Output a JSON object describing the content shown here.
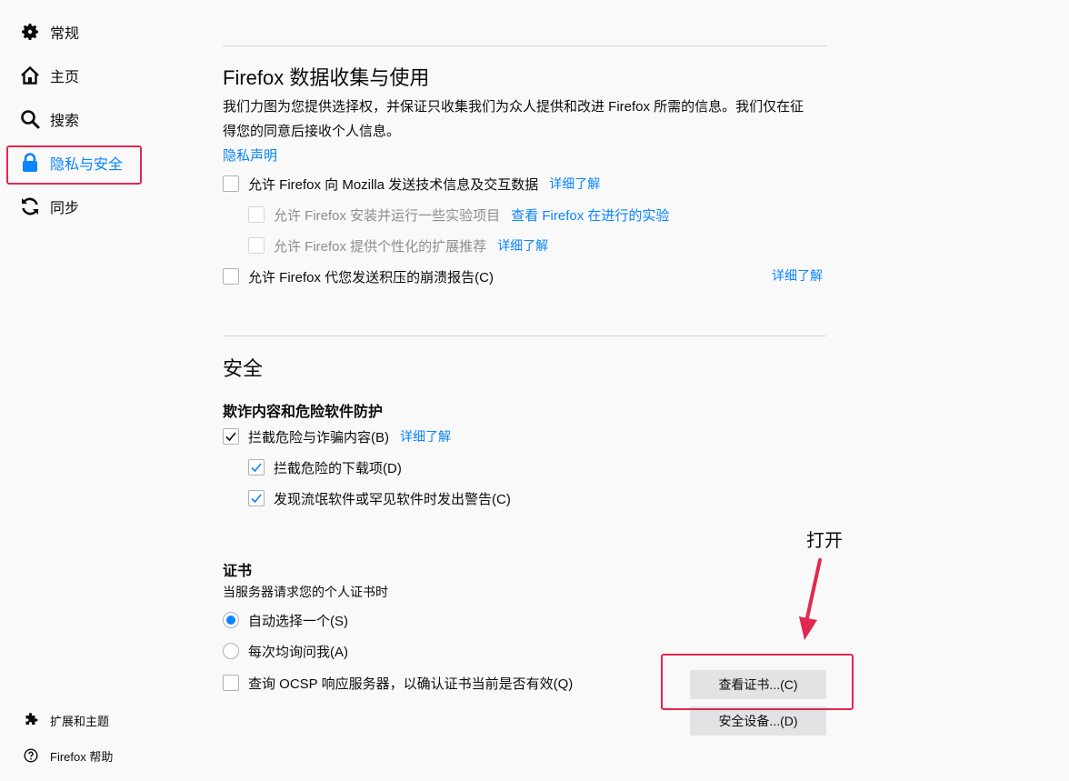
{
  "sidebar": {
    "items": [
      {
        "label": "常规",
        "icon": "gear-icon"
      },
      {
        "label": "主页",
        "icon": "home-icon"
      },
      {
        "label": "搜索",
        "icon": "search-icon"
      },
      {
        "label": "隐私与安全",
        "icon": "lock-icon",
        "active": true
      },
      {
        "label": "同步",
        "icon": "sync-icon"
      }
    ],
    "footer": [
      {
        "label": "扩展和主题",
        "icon": "puzzle-icon"
      },
      {
        "label": "Firefox 帮助",
        "icon": "help-icon"
      }
    ]
  },
  "data_collection": {
    "title": "Firefox 数据收集与使用",
    "desc_line1": "我们力图为您提供选择权，并保证只收集我们为众人提供和改进 Firefox 所需的信息。我们仅在征",
    "desc_line2": "得您的同意后接收个人信息。",
    "privacy_link": "隐私声明",
    "opt_tech": "允许 Firefox 向 Mozilla 发送技术信息及交互数据",
    "opt_tech_link": "详细了解",
    "opt_studies": "允许 Firefox 安装并运行一些实验项目",
    "opt_studies_link": "查看 Firefox 在进行的实验",
    "opt_ext": "允许 Firefox 提供个性化的扩展推荐",
    "opt_ext_link": "详细了解",
    "opt_crash": "允许 Firefox 代您发送积压的崩溃报告(C)",
    "opt_crash_link": "详细了解"
  },
  "security": {
    "title": "安全",
    "phishing_header": "欺诈内容和危险软件防护",
    "block_dangerous": "拦截危险与诈骗内容(B)",
    "block_dangerous_link": "详细了解",
    "block_downloads": "拦截危险的下载项(D)",
    "warn_unwanted": "发现流氓软件或罕见软件时发出警告(C)"
  },
  "certificates": {
    "header": "证书",
    "desc": "当服务器请求您的个人证书时",
    "radio_auto": "自动选择一个(S)",
    "radio_ask": "每次均询问我(A)",
    "ocsp": "查询 OCSP 响应服务器，以确认证书当前是否有效(Q)",
    "view_button": "查看证书...(C)",
    "devices_button": "安全设备...(D)"
  },
  "annotation": {
    "text": "打开",
    "color": "#e22850"
  }
}
